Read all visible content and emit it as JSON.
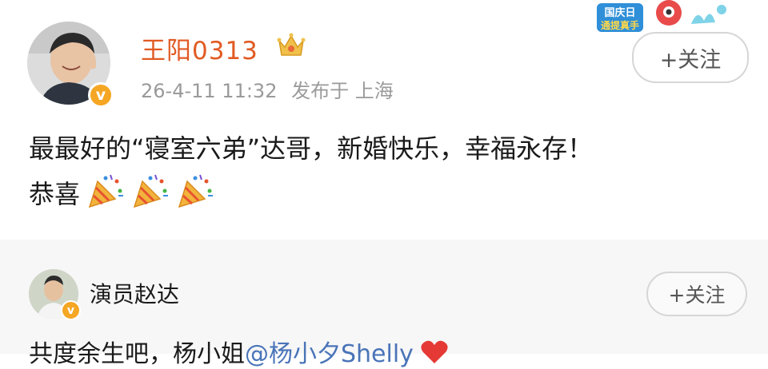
{
  "post": {
    "username": "王阳0313",
    "timestamp": "26-4-11 11:32",
    "location": "发布于 上海",
    "follow_label": "+关注",
    "corner_badge_text": "国庆日通提真手",
    "text_line1": "最最好的“寝室六弟”达哥，新婚快乐，幸福永存！",
    "text_line2": "恭喜",
    "verified_mark": "v"
  },
  "comment": {
    "username": "演员赵达",
    "follow_label": "+关注",
    "text_before": "共度余生吧，杨小姐",
    "mention": "@杨小夕Shelly",
    "verified_mark": "v"
  },
  "colors": {
    "username_orange": "#e15a23",
    "verified_gold": "#f5a623",
    "mention_blue": "#4a74b8",
    "heart_red": "#e53935"
  },
  "icons": [
    "crown-icon",
    "party-popper-icon",
    "heart-icon",
    "verified-icon"
  ]
}
